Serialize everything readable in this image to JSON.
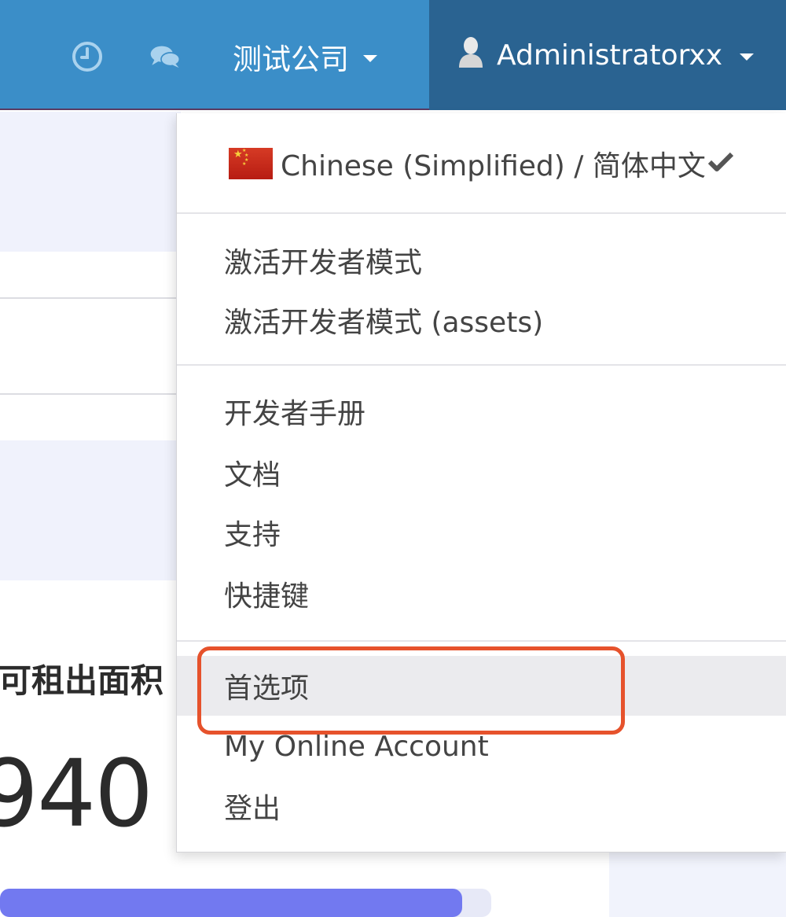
{
  "navbar": {
    "background": "#3b8ec8",
    "user_background": "#2a6391",
    "activity_icon": "clock-icon",
    "messaging_icon": "chat-icon",
    "company_name": "测试公司",
    "user_name": "Administratorxx",
    "user_icon": "user-avatar-icon"
  },
  "background_page": {
    "partial_title": "可租出面积",
    "partial_value": "940",
    "progress_fraction": 0.94,
    "progress_color": "#7279f0"
  },
  "user_dropdown": {
    "language": {
      "flag_icon": "china-flag-icon",
      "label": "Chinese (Simplified) / 简体中文",
      "check_icon": "checkmark-icon",
      "selected": true
    },
    "group_developer": [
      {
        "label": "激活开发者模式"
      },
      {
        "label": "激活开发者模式 (assets)"
      }
    ],
    "group_help": [
      {
        "label": "开发者手册"
      },
      {
        "label": "文档"
      },
      {
        "label": "支持"
      },
      {
        "label": "快捷键"
      }
    ],
    "group_account": [
      {
        "label": "首选项",
        "highlighted": true
      },
      {
        "label": "My Online Account"
      },
      {
        "label": "登出"
      }
    ],
    "highlight_color": "#e6522c"
  }
}
